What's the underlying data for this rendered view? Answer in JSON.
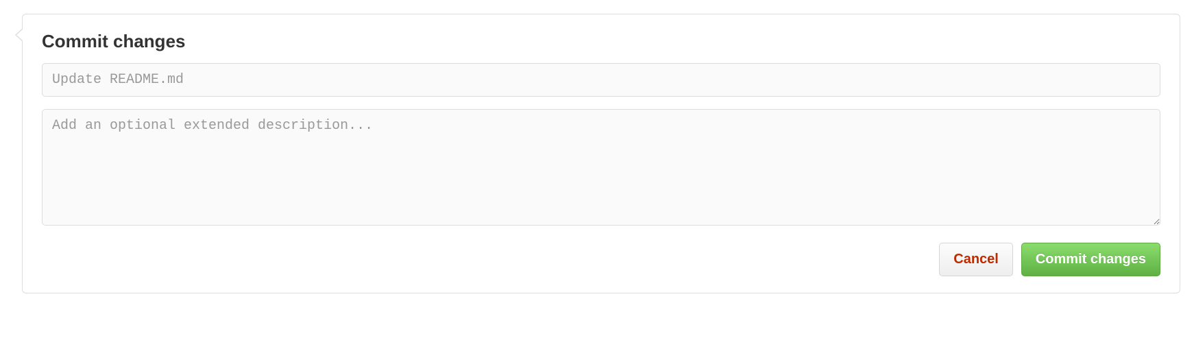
{
  "form": {
    "title": "Commit changes",
    "summary": {
      "value": "",
      "placeholder": "Update README.md"
    },
    "description": {
      "value": "",
      "placeholder": "Add an optional extended description..."
    },
    "actions": {
      "cancel_label": "Cancel",
      "submit_label": "Commit changes"
    }
  }
}
